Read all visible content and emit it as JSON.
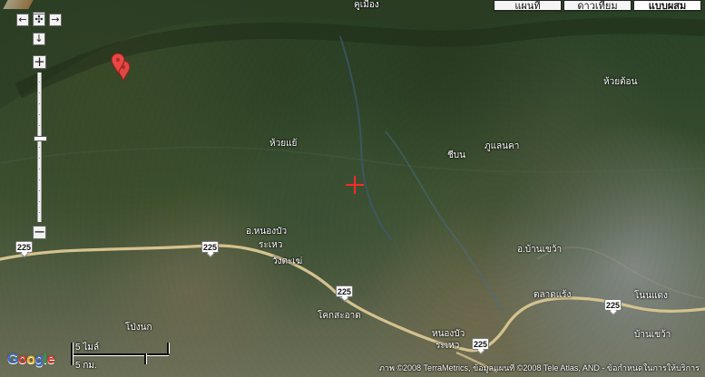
{
  "map": {
    "tabs": [
      {
        "label": "แผนที่"
      },
      {
        "label": "ดาวเทียม"
      },
      {
        "label": "แบบผสม"
      }
    ],
    "controls": {
      "up": "↑",
      "left": "←",
      "center": "✣",
      "right": "→",
      "down": "↓",
      "zoom_in": "+",
      "zoom_out": "−",
      "zoom_level": 0.43
    },
    "labels": [
      {
        "id": "top-town",
        "text": "คูเมือง"
      },
      {
        "id": "huai-ton",
        "text": "ห้วยต้อน"
      },
      {
        "id": "huai-yae",
        "text": "ห้วยแย้"
      },
      {
        "id": "phu-laen-kha",
        "text": "ภูแลนคา"
      },
      {
        "id": "chipan",
        "text": "ชีบน"
      },
      {
        "id": "amphoe-nong-bua",
        "text": "อ.หนองบัว"
      },
      {
        "id": "rahaeo",
        "text": "ระเหว"
      },
      {
        "id": "wang-takhe",
        "text": "วังตะเฆ่"
      },
      {
        "id": "amphoe-ban-khwao",
        "text": "อ.บ้านเขว้า"
      },
      {
        "id": "talat-raeng",
        "text": "ตลาดแร้ง"
      },
      {
        "id": "non-daeng",
        "text": "โนนแดง"
      },
      {
        "id": "khok-sa-at",
        "text": "โคกสะอาด"
      },
      {
        "id": "pong-nok",
        "text": "โป่งนก"
      },
      {
        "id": "nong-bua-rahaeo",
        "text": "หนองบัว"
      },
      {
        "id": "rahaeo-bottom",
        "text": "ระเหว"
      },
      {
        "id": "ban-khwao",
        "text": "บ้านเขว้า"
      }
    ],
    "road_shields": [
      {
        "label": "225"
      },
      {
        "label": "225"
      },
      {
        "label": "225"
      },
      {
        "label": "225"
      },
      {
        "label": "225"
      }
    ],
    "scale": {
      "top": "5 ไมล์",
      "bottom": "5 กม."
    },
    "brand": {
      "name": "Google",
      "colors": [
        "#3f6ec7",
        "#db3c2f",
        "#f3b52b",
        "#3f6ec7",
        "#2f9b48",
        "#db3c2f"
      ]
    },
    "attribution": "ภาพ ©2008 TerraMetrics, ข้อมูลแผนที่ ©2008 Tele Atlas, AND - ข้อกำหนดในการให้บริการ",
    "colors": {
      "road": "#d5c28f",
      "marker": "#e84844",
      "crosshair": "#ff2a2a",
      "river": "#405d7d"
    }
  }
}
